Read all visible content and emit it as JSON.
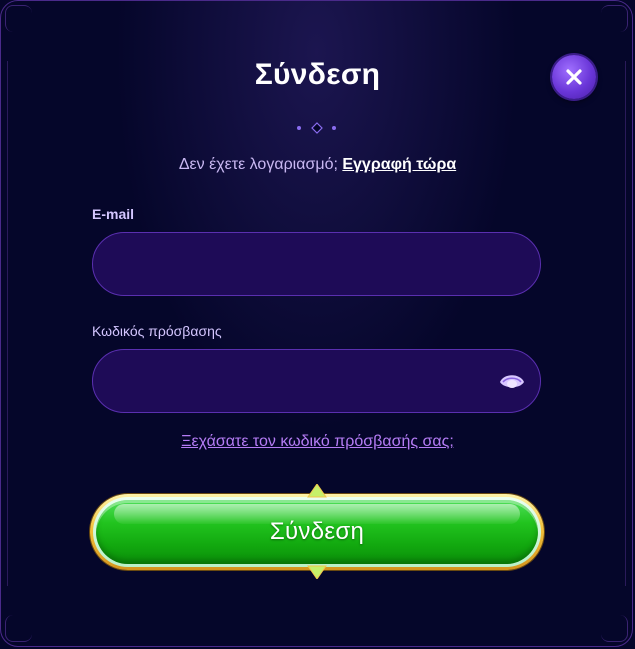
{
  "modal": {
    "title": "Σύνδεση",
    "close_icon": "close-icon"
  },
  "signup": {
    "prompt": "Δεν έχετε λογαριασμό;",
    "link": "Εγγραφή τώρα"
  },
  "form": {
    "email_label": "E-mail",
    "email_value": "",
    "password_label": "Κωδικός πρόσβασης",
    "password_value": "",
    "password_icon": "eye-icon",
    "forgot_link": "Ξεχάσατε τον κωδικό πρόσβασής σας;",
    "submit_label": "Σύνδεση"
  },
  "colors": {
    "background": "#05062a",
    "input_fill": "#1e0b57",
    "accent_purple": "#6a36d8",
    "button_green": "#22c41f",
    "button_border_gold": "#f3c23c",
    "link_purple": "#b57cf5"
  }
}
